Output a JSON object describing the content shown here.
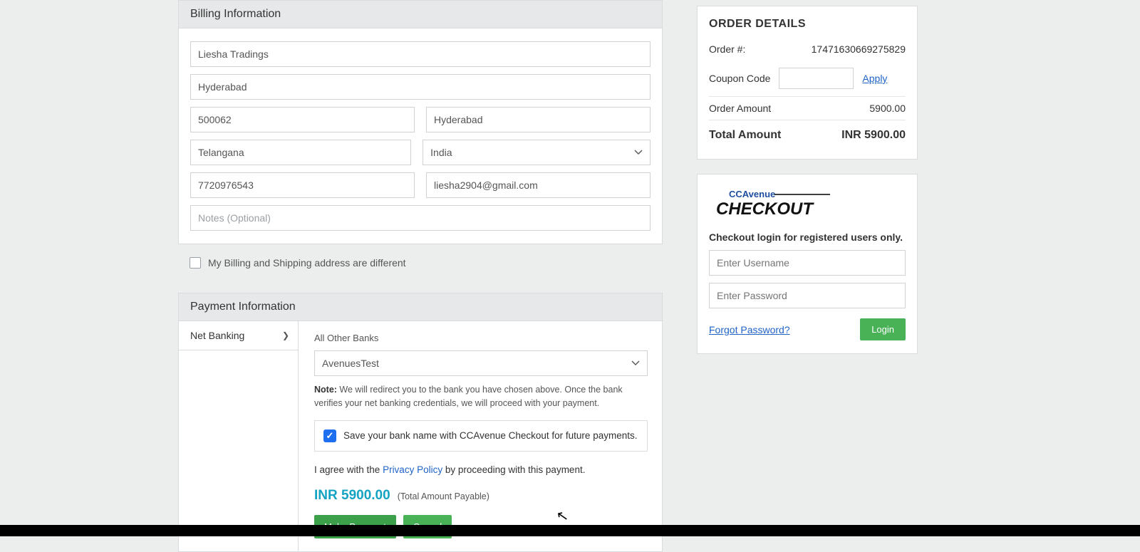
{
  "billing": {
    "header": "Billing Information",
    "name": "Liesha Tradings",
    "address": "Hyderabad",
    "zip": "500062",
    "city": "Hyderabad",
    "state": "Telangana",
    "country": "India",
    "phone": "7720976543",
    "email": "liesha2904@gmail.com",
    "notes_placeholder": "Notes (Optional)",
    "diff_address_label": "My Billing and Shipping address are different"
  },
  "payment": {
    "header": "Payment Information",
    "tab_netbanking": "Net Banking",
    "all_other_banks_label": "All Other Banks",
    "bank_selected": "AvenuesTest",
    "note_prefix": "Note:",
    "note_text": " We will redirect you to the bank you have chosen above. Once the bank verifies your net banking credentials, we will proceed with your payment.",
    "save_text": "Save your bank name with CCAvenue Checkout for future payments.",
    "agree_pre": "I agree with the ",
    "agree_link": "Privacy Policy",
    "agree_post": " by proceeding with this payment.",
    "amount_display": "INR 5900.00",
    "amount_note": "(Total Amount Payable)",
    "make_payment": "Make Payment",
    "cancel": "Cancel"
  },
  "order": {
    "title": "ORDER DETAILS",
    "order_no_label": "Order  #:",
    "order_no": "17471630669275829",
    "coupon_label": "Coupon Code",
    "apply": "Apply",
    "order_amount_label": "Order  Amount",
    "order_amount": "5900.00",
    "total_label": "Total Amount",
    "total_value": "INR 5900.00"
  },
  "checkout_login": {
    "brand_top": "CCAvenue",
    "brand_bottom": "CHECKOUT",
    "title": "Checkout login for registered users only.",
    "username_placeholder": "Enter Username",
    "password_placeholder": "Enter Password",
    "forgot": "Forgot Password?",
    "login": "Login"
  }
}
